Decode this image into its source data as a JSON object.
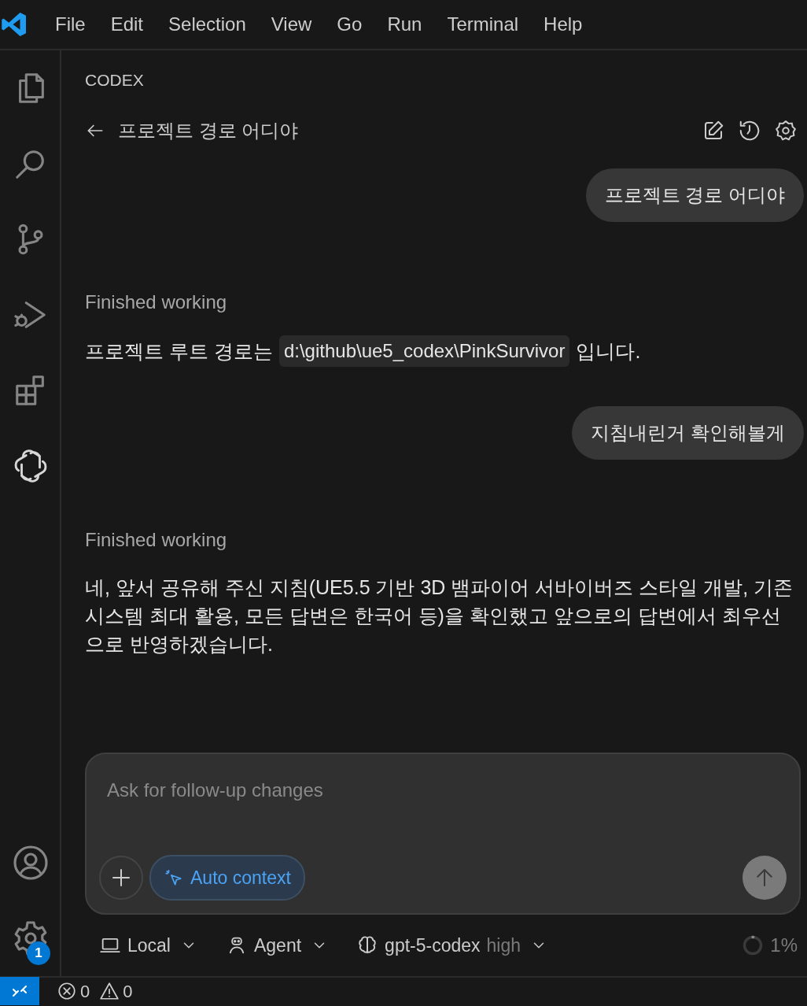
{
  "menu": [
    "File",
    "Edit",
    "Selection",
    "View",
    "Go",
    "Run",
    "Terminal",
    "Help"
  ],
  "activity_bar": [
    {
      "selected": false
    },
    {
      "selected": false
    },
    {
      "selected": false
    },
    {
      "selected": false
    },
    {
      "selected": false
    },
    {
      "selected": true
    }
  ],
  "activity_bar_bottom": {
    "settings_badge": "1"
  },
  "panel": {
    "title": "CODEX",
    "thread_title": "프로젝트 경로 어디야"
  },
  "messages": [
    {
      "kind": "user",
      "text": "프로젝트 경로 어디야"
    },
    {
      "kind": "status",
      "text": "Finished working"
    },
    {
      "kind": "assistant",
      "text": "프로젝트 루트 경로는",
      "code": "d:\\github\\ue5_codex\\PinkSurvivor",
      "text_after": "입니다."
    },
    {
      "kind": "user",
      "text": "지침내린거 확인해볼게"
    },
    {
      "kind": "status",
      "text": "Finished working"
    },
    {
      "kind": "assistant",
      "text": "네, 앞서 공유해 주신 지침(UE5.5 기반 3D 뱀파이어 서바이버즈 스타일 개발, 기존 시스템 최대 활용, 모든 답변은 한국어 등)을 확인했고 앞으로의 답변에서 최우선으로 반영하겠습니다."
    }
  ],
  "composer": {
    "placeholder": "Ask for follow-up changes",
    "chip": "Auto context"
  },
  "footer": {
    "environment": "Local",
    "mode": "Agent",
    "model": "gpt-5-codex",
    "effort": "high",
    "usage": "1%"
  },
  "status_bar": {
    "errors": "0",
    "warnings": "0"
  }
}
